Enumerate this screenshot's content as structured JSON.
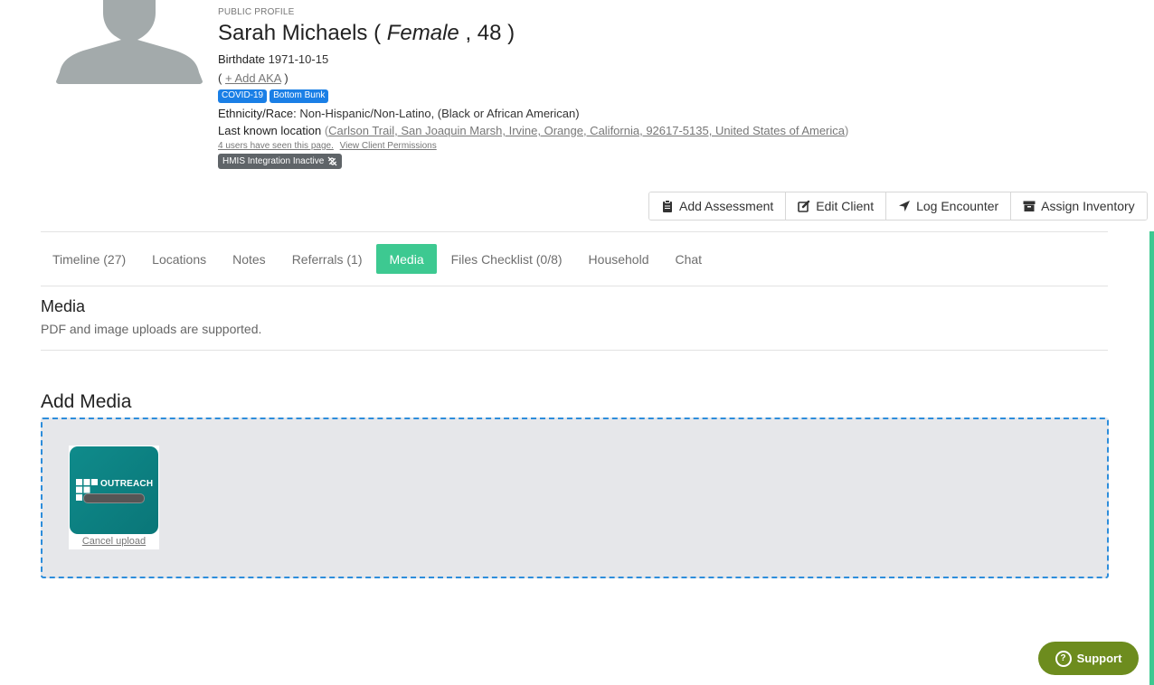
{
  "profile": {
    "eyebrow": "PUBLIC PROFILE",
    "name": "Sarah Michaels",
    "gender": "Female",
    "age": "48",
    "birthdate_label": "Birthdate",
    "birthdate": "1971-10-15",
    "add_aka": "+ Add AKA",
    "tags": [
      "COVID-19",
      "Bottom Bunk"
    ],
    "ethnicity_label": "Ethnicity/Race:",
    "ethnicity": "Non-Hispanic/Non-Latino, (Black or African American)",
    "location_label": "Last known location",
    "location": "Carlson Trail, San Joaquin Marsh, Irvine, Orange, California, 92617-5135, United States of America",
    "seen_text": "4 users have seen this page.",
    "permissions_link": "View Client Permissions",
    "hmis_badge": "HMIS Integration Inactive"
  },
  "actions": {
    "add_assessment": "Add Assessment",
    "edit_client": "Edit Client",
    "log_encounter": "Log Encounter",
    "assign_inventory": "Assign Inventory"
  },
  "tabs": [
    {
      "label": "Timeline (27)"
    },
    {
      "label": "Locations"
    },
    {
      "label": "Notes"
    },
    {
      "label": "Referrals (1)"
    },
    {
      "label": "Media"
    },
    {
      "label": "Files Checklist (0/8)"
    },
    {
      "label": "Household"
    },
    {
      "label": "Chat"
    }
  ],
  "media_section": {
    "title": "Media",
    "subtitle": "PDF and image uploads are supported.",
    "add_title": "Add Media",
    "upload_logo_text": "OUTREACH",
    "cancel_upload": "Cancel upload"
  },
  "support": {
    "label": "Support"
  },
  "colors": {
    "accent": "#3dc991",
    "tag": "#1a7fe6",
    "support": "#6d8c1e",
    "dropzone_border": "#2d8ddb"
  }
}
